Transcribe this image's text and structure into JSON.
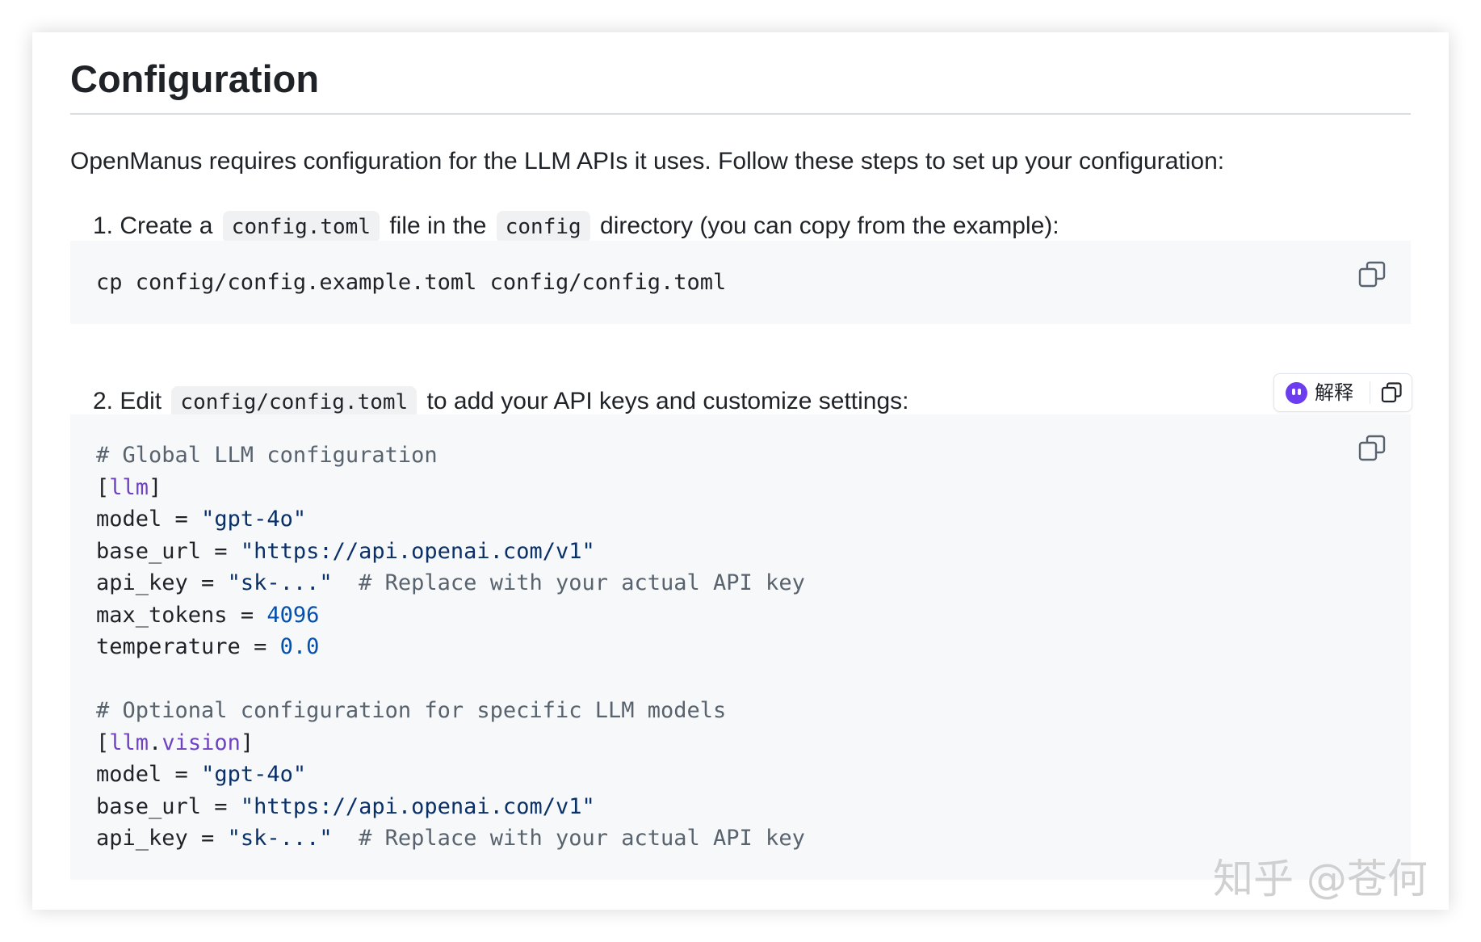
{
  "section": {
    "heading": "Configuration",
    "intro": "OpenManus requires configuration for the LLM APIs it uses. Follow these steps to set up your configuration:"
  },
  "steps": [
    {
      "number": "1.",
      "text_a": "Create a",
      "code_a": "config.toml",
      "text_b": "file in the",
      "code_b": "config",
      "text_c": "directory (you can copy from the example):"
    },
    {
      "number": "2.",
      "text_a": "Edit",
      "code_a": "config/config.toml",
      "text_b": "to add your API keys and customize settings:"
    }
  ],
  "code_block_1": {
    "command": "cp config/config.example.toml config/config.toml",
    "copy_icon": "copy-icon"
  },
  "code_block_2": {
    "comment_1": "# Global LLM configuration",
    "section_1": "llm",
    "model_key": "model",
    "model_val": "\"gpt-4o\"",
    "base_url_key": "base_url",
    "base_url_val": "\"https://api.openai.com/v1\"",
    "api_key_key": "api_key",
    "api_key_val": "\"sk-...\"",
    "api_key_comment": "# Replace with your actual API key",
    "max_tokens_key": "max_tokens",
    "max_tokens_val": "4096",
    "temperature_key": "temperature",
    "temperature_val": "0.0",
    "comment_2": "# Optional configuration for specific LLM models",
    "section_2a": "llm",
    "section_2b": "vision",
    "model2_val": "\"gpt-4o\"",
    "base_url2_val": "\"https://api.openai.com/v1\"",
    "api_key2_val": "\"sk-...\"",
    "api_key2_comment": "# Replace with your actual API key",
    "copy_icon": "copy-icon"
  },
  "explain_popup": {
    "label": "解释",
    "logo_icon": "assistant-logo-icon",
    "copy_icon": "copy-icon"
  },
  "watermark": "知乎 @苍何",
  "colors": {
    "text": "#1f2328",
    "code_bg": "#f6f8fa",
    "inline_code_bg": "#eff1f3",
    "comment": "#59636e",
    "section": "#6f42c1",
    "string": "#0a3069",
    "number": "#0550ae",
    "accent_logo": "#6c3cf0"
  }
}
